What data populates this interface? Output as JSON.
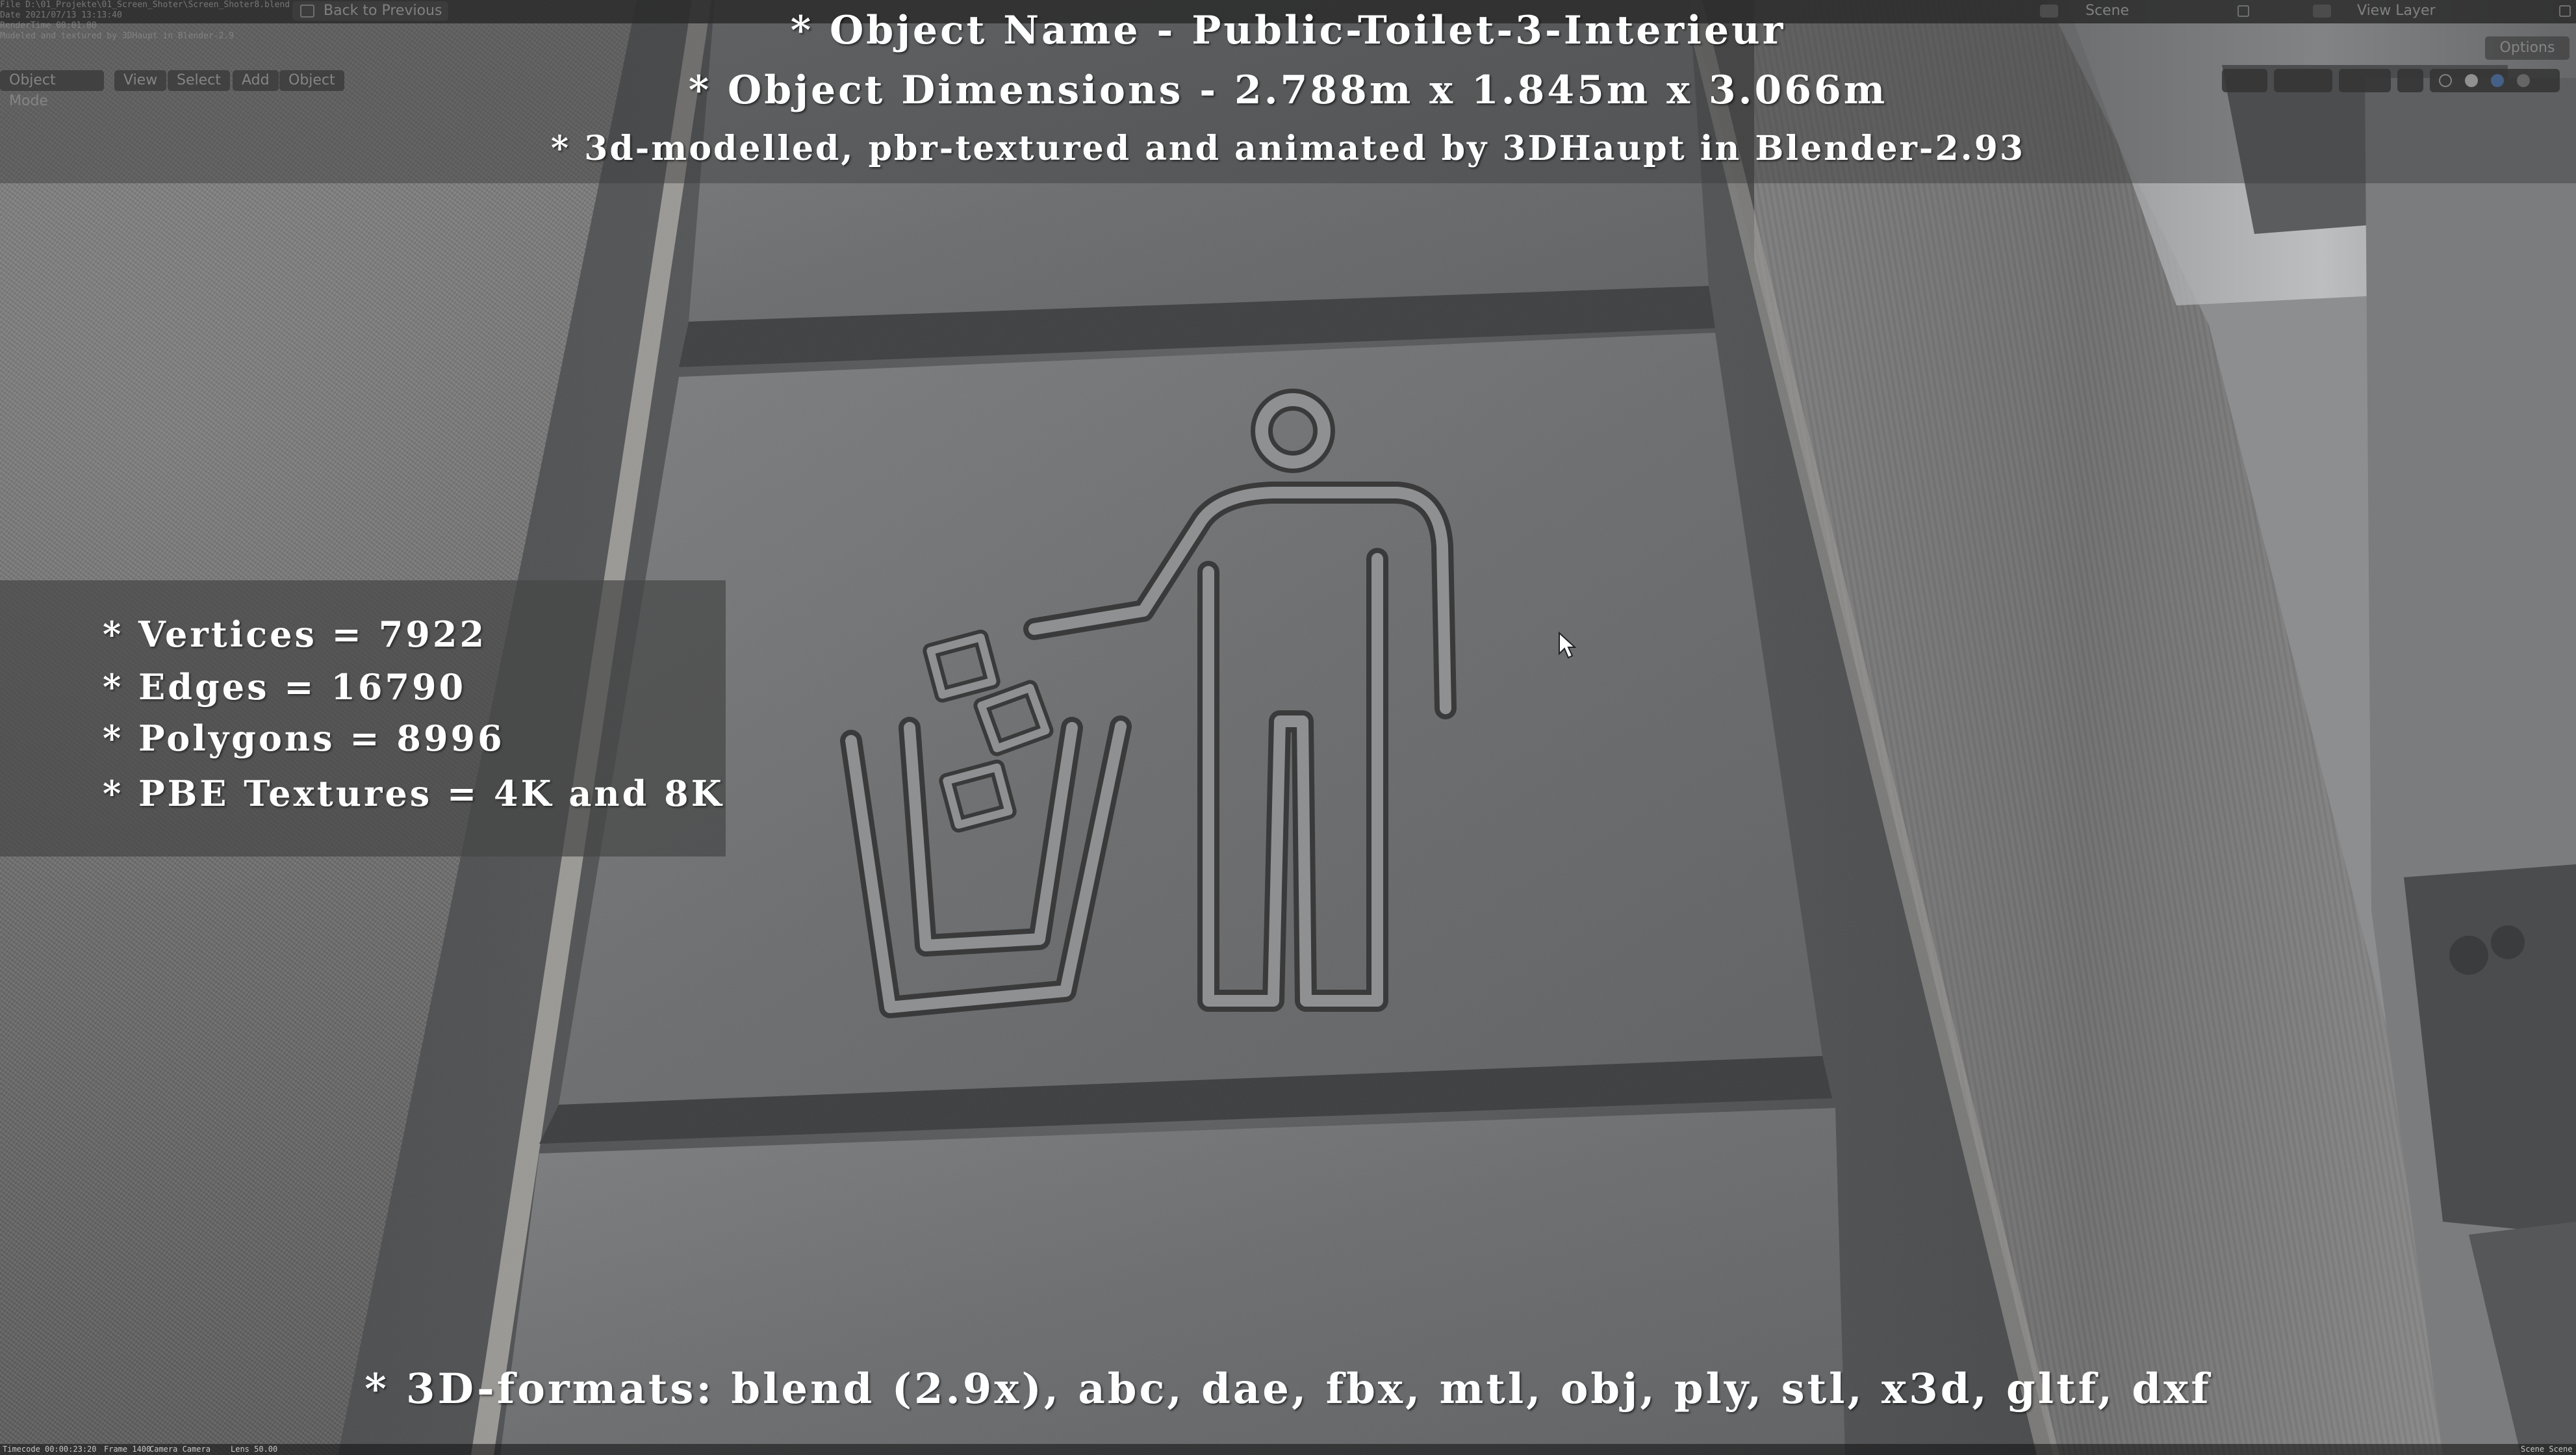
{
  "overlay": {
    "object_name": "* Object Name - Public-Toilet-3-Interieur",
    "object_dimensions": "* Object Dimensions -  2.788m x 1.845m x 3.066m",
    "credit": "* 3d-modelled, pbr-textured and animated by 3DHaupt in Blender-2.93",
    "stats": [
      "* Vertices = 7922",
      "* Edges = 16790",
      "* Polygons = 8996",
      "* PBE Textures = 4K and 8K"
    ],
    "formats": "* 3D-formats: blend (2.9x), abc, dae, fbx, mtl, obj, ply, stl, x3d, gltf, dxf"
  },
  "topbar": {
    "back_button": "Back to Previous",
    "scene_label": "Scene",
    "view_layer_label": "View Layer"
  },
  "render_info": {
    "line1": "File D:\\01_Projekte\\01_Screen_Shoter\\Screen_Shoter8.blend",
    "line2": "Date 2021/07/13 13:13:40",
    "line3": "RenderTime 00:01.00",
    "line4": "Modeled and textured by 3DHaupt in Blender-2.9"
  },
  "header": {
    "mode": "Object Mode",
    "menu_view": "View",
    "menu_select": "Select",
    "menu_add": "Add",
    "menu_object": "Object",
    "options": "Options"
  },
  "status_bar": {
    "timecode": "Timecode 00:00:23:20",
    "frame": "Frame 1400",
    "camera": "Camera Camera",
    "lens": "Lens 50.00",
    "scene": "Scene Scene"
  },
  "colors": {
    "overlay_text": "#ffffff",
    "panel_bg": "#464646",
    "metal_plate": "#6f7173",
    "carpet": "#767676"
  },
  "icons": [
    "trash-pictogram-icon",
    "mouse-cursor-icon",
    "back-icon",
    "scene-icon",
    "view-layer-icon"
  ]
}
